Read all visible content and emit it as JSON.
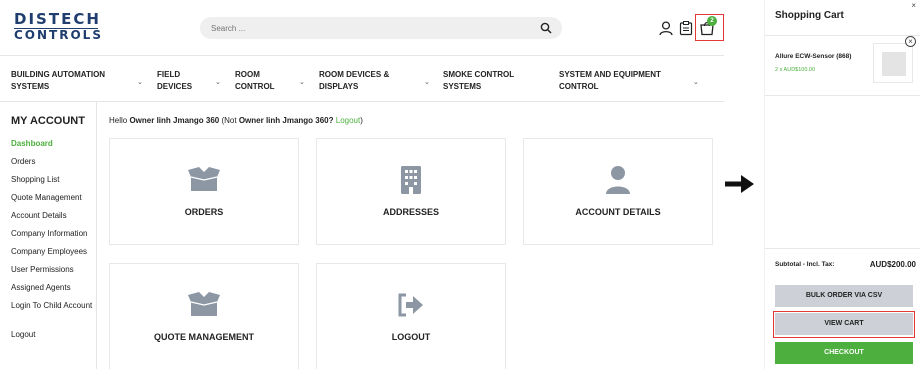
{
  "brand": {
    "line1": "DISTECH",
    "line2": "CONTROLS"
  },
  "search": {
    "placeholder": "Search ..."
  },
  "header": {
    "cart_count": "2"
  },
  "nav": [
    {
      "l1": "BUILDING AUTOMATION",
      "l2": "SYSTEMS"
    },
    {
      "l1": "FIELD",
      "l2": "DEVICES"
    },
    {
      "l1": "ROOM",
      "l2": "CONTROL"
    },
    {
      "l1": "ROOM DEVICES &",
      "l2": "DISPLAYS"
    },
    {
      "l1": "SMOKE CONTROL",
      "l2": "SYSTEMS"
    },
    {
      "l1": "SYSTEM AND EQUIPMENT",
      "l2": "CONTROL"
    }
  ],
  "sidebar": {
    "title": "MY ACCOUNT",
    "items": [
      "Dashboard",
      "Orders",
      "Shopping List",
      "Quote Management",
      "Account Details",
      "Company Information",
      "Company Employees",
      "User Permissions",
      "Assigned Agents",
      "Login To Child Account",
      "Logout"
    ]
  },
  "hello": {
    "prefix": "Hello ",
    "name": "Owner linh Jmango 360",
    "mid": " (Not ",
    "name2": "Owner linh Jmango 360?",
    "logout": " Logout",
    "suffix": ")"
  },
  "cards": [
    "ORDERS",
    "ADDRESSES",
    "ACCOUNT DETAILS",
    "QUOTE MANAGEMENT",
    "LOGOUT"
  ],
  "cart": {
    "title": "Shopping Cart",
    "close": "×",
    "remove": "×",
    "item_name": "Allure ECW-Sensor (868)",
    "item_qty": "2 x AUD$100.00",
    "subtotal_label": "Subtotal - Incl. Tax:",
    "subtotal_value": "AUD$200.00",
    "bulk_label": "BULK ORDER VIA CSV",
    "view_label": "VIEW CART",
    "checkout_label": "CHECKOUT"
  },
  "colors": {
    "accent_green": "#4caf3e",
    "brand_blue": "#1f3d6e",
    "highlight_red": "#e53935"
  }
}
